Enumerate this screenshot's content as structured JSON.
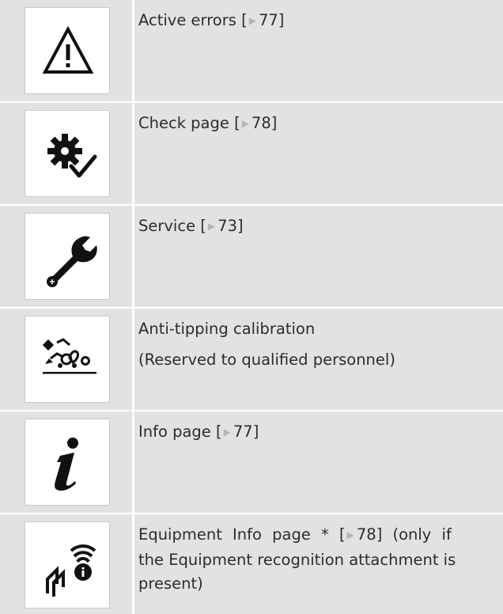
{
  "rows": [
    {
      "icon": "warning-triangle-icon",
      "text": "Active errors [",
      "ref": "77",
      "suffix": "]"
    },
    {
      "icon": "gear-check-icon",
      "text": "Check page [",
      "ref": "78",
      "suffix": "]"
    },
    {
      "icon": "wrench-icon",
      "text": "Service [",
      "ref": "73",
      "suffix": "]"
    },
    {
      "icon": "anti-tipping-calibration-icon",
      "text": "Anti-tipping calibration",
      "subtext": "(Reserved to qualified personnel)"
    },
    {
      "icon": "info-icon",
      "text": "Info page [",
      "ref": "77",
      "suffix": "]"
    },
    {
      "icon": "equipment-info-icon",
      "line1_a": "Equipment Info page * [",
      "ref": "78",
      "line1_b": "] (only if",
      "line2": "the Equipment recognition attachment is",
      "line3": "present)"
    }
  ],
  "ref_arrow_glyph": "▶",
  "colors": {
    "cell_bg": "#e2e2e2",
    "icon_bg": "#ffffff",
    "text": "#2c2c2c"
  }
}
